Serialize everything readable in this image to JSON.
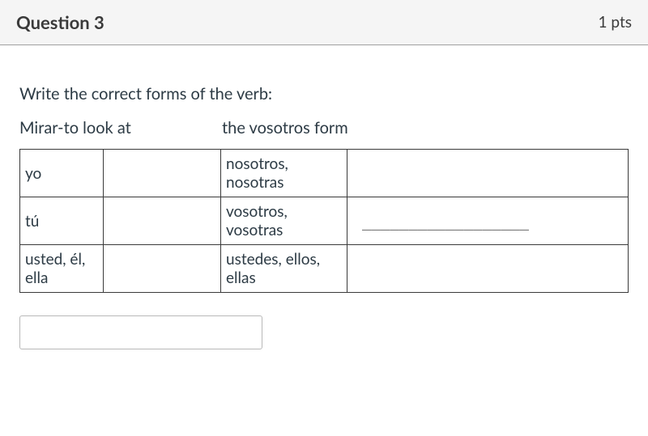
{
  "header": {
    "title": "Question 3",
    "points": "1 pts"
  },
  "prompt": "Write the correct forms of the verb:",
  "sub": {
    "left": "Mirar-to look at",
    "right": "the vosotros form"
  },
  "table": {
    "rows": [
      {
        "c1": "yo",
        "c2": "",
        "c3": "nosotros, nosotras",
        "c4": ""
      },
      {
        "c1": "tú",
        "c2": "",
        "c3": "vosotros, vosotras",
        "c4": "__________________"
      },
      {
        "c1": "usted, él, ella",
        "c2": "",
        "c3": "ustedes, ellos, ellas",
        "c4": ""
      }
    ]
  },
  "answer": {
    "value": ""
  }
}
